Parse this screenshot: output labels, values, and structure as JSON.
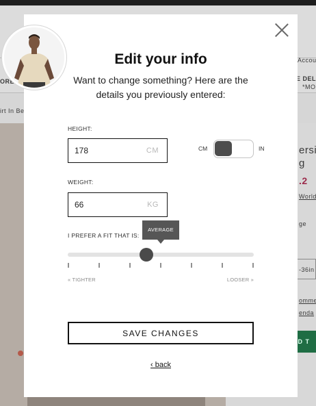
{
  "background": {
    "nav_left": "ORE",
    "nav_right_top": "Accoun",
    "nav_right_mid": "E DEL",
    "nav_right_sub": "*MO",
    "breadcrumb": "irt In Be",
    "product_title_1": "ersi",
    "product_title_2": "g",
    "price": ".2",
    "shipping": "Worldw",
    "size_label": "ge",
    "size_value": "-36in",
    "link_1": "omme",
    "link_2": "enda",
    "add_button": "DD T"
  },
  "modal": {
    "title": "Edit your info",
    "subtitle": "Want to change something? Here are the details you previously entered:",
    "height": {
      "label": "HEIGHT:",
      "value": "178",
      "unit": "CM"
    },
    "unit_toggle": {
      "left": "CM",
      "right": "IN",
      "selected": "CM"
    },
    "weight": {
      "label": "WEIGHT:",
      "value": "66",
      "unit": "KG"
    },
    "fit": {
      "label": "I PREFER A FIT THAT IS:",
      "tooltip": "AVERAGE",
      "min_label": "« TIGHTER",
      "max_label": "LOOSER »",
      "steps": 7,
      "selected_step": 3
    },
    "save_label": "SAVE CHANGES",
    "back_label": "‹ back"
  },
  "colors": {
    "accent_dark": "#4a4a4a",
    "price": "#9c2c4c",
    "add_button": "#1f6d44"
  }
}
